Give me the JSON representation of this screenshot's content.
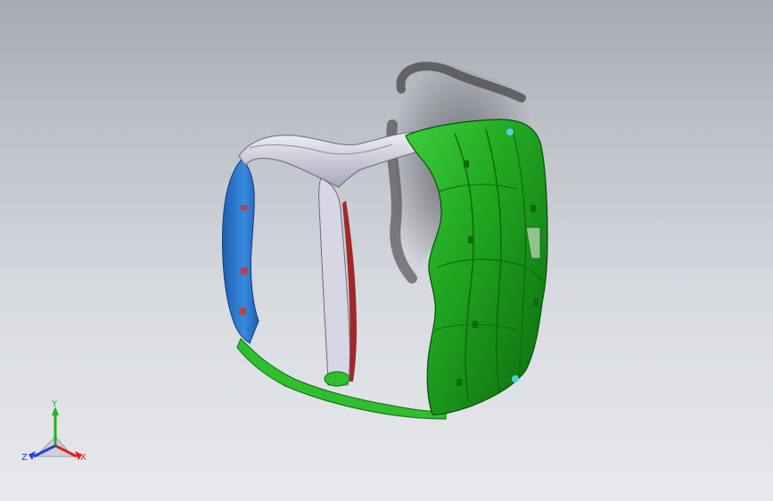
{
  "viewport": {
    "background_top": "#a6abb3",
    "background_bottom": "#e7e9ec"
  },
  "model": {
    "colors": {
      "main_shell": "#1fa31f",
      "main_shell_dark": "#0e6a0e",
      "frame_edge": "#b8b8cc",
      "left_panel": "#2f80d8",
      "accent_red": "#b03030",
      "accent_cyan": "#4fd0e0",
      "shadow": "#3a3a3a"
    }
  },
  "triad": {
    "x_label": "X",
    "y_label": "Y",
    "z_label": "Z",
    "x_color": "#e02020",
    "y_color": "#20b020",
    "z_color": "#2040e0"
  }
}
